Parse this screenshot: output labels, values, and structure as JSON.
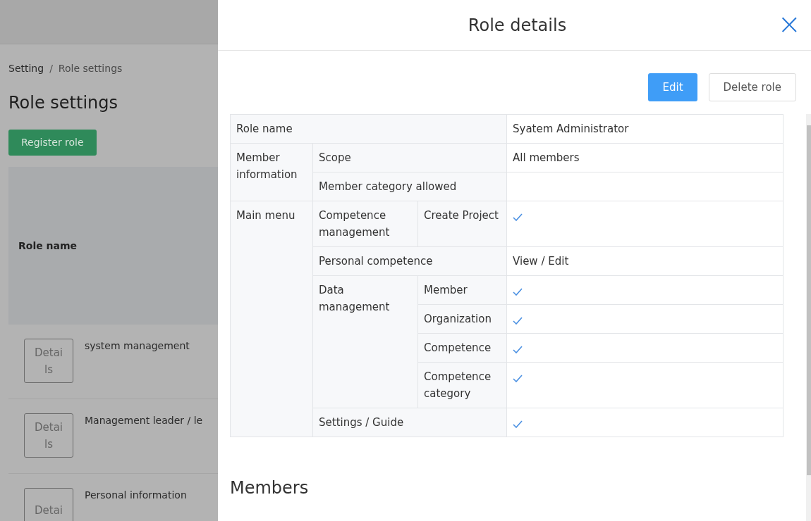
{
  "background_page": {
    "breadcrumb": [
      {
        "label": "Setting"
      },
      {
        "label": "Role settings"
      }
    ],
    "breadcrumb_separator": "/",
    "title": "Role settings",
    "register_button": "Register role",
    "table_header": "Role name",
    "rows": [
      {
        "button": "Details",
        "name": "system management"
      },
      {
        "button": "Details",
        "name": "Management leader / le"
      },
      {
        "button": "Detai",
        "name": "Personal information"
      }
    ]
  },
  "drawer": {
    "title": "Role details",
    "close": "×",
    "buttons": [
      {
        "label": "Edit",
        "kind": "primary"
      },
      {
        "label": "Delete role",
        "kind": "secondary"
      }
    ],
    "role_name": {
      "label": "Role name",
      "value": "Syatem Administrator"
    },
    "sections": [
      {
        "label": "Member information",
        "items": [
          {
            "label": "Scope",
            "value": "All members"
          },
          {
            "label": "Member category allowed"
          }
        ]
      },
      {
        "label": "Main menu",
        "items": [
          {
            "label": "Competence management",
            "children": [
              {
                "label": "Create Project",
                "checked": true
              }
            ]
          },
          {
            "label": "Personal competence",
            "value": "View / Edit"
          },
          {
            "label": "Data management",
            "children": [
              {
                "label": "Member",
                "checked": true
              },
              {
                "label": "Organization",
                "checked": true
              },
              {
                "label": "Competence",
                "checked": true
              },
              {
                "label": "Competence category",
                "checked": true
              }
            ]
          },
          {
            "label": "Settings / Guide",
            "checked": true
          }
        ]
      }
    ],
    "members_heading": "Members"
  }
}
